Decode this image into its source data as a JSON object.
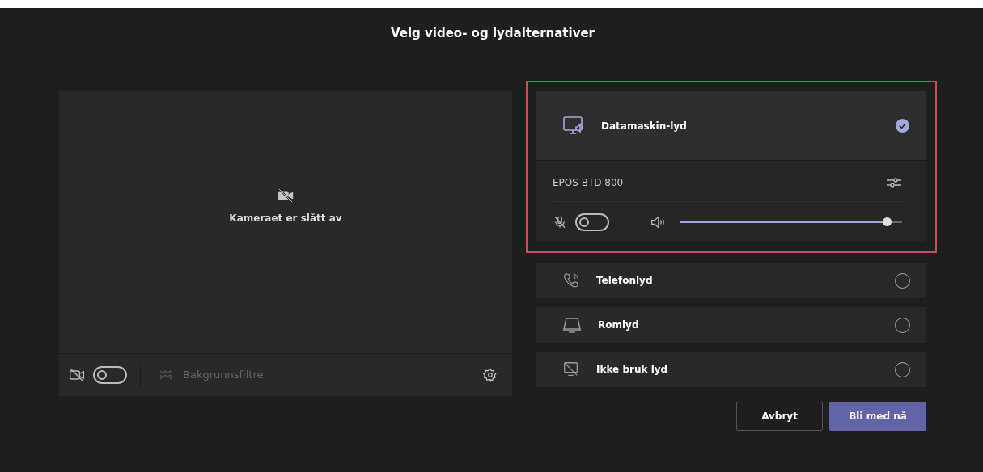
{
  "title": "Velg video- og lydalternativer",
  "camera": {
    "message": "Kameraet er slått av",
    "camera_on": false,
    "background_filters": {
      "label": "Bakgrunnsfiltre",
      "disabled": true
    }
  },
  "audio_options": [
    {
      "kind": "computer",
      "label": "Datamaskin-lyd",
      "selected": true,
      "highlighted": true
    },
    {
      "kind": "phone",
      "label": "Telefonlyd",
      "selected": false,
      "highlighted": false
    },
    {
      "kind": "room",
      "label": "Romlyd",
      "selected": false,
      "highlighted": false
    },
    {
      "kind": "none",
      "label": "Ikke bruk lyd",
      "selected": false,
      "highlighted": false
    }
  ],
  "device": {
    "name": "EPOS BTD 800",
    "mic_on": false,
    "volume": {
      "level": 0.95
    }
  },
  "buttons": [
    {
      "label": "Avbryt",
      "kind": "secondary"
    },
    {
      "label": "Bli med nå",
      "kind": "primary"
    }
  ]
}
